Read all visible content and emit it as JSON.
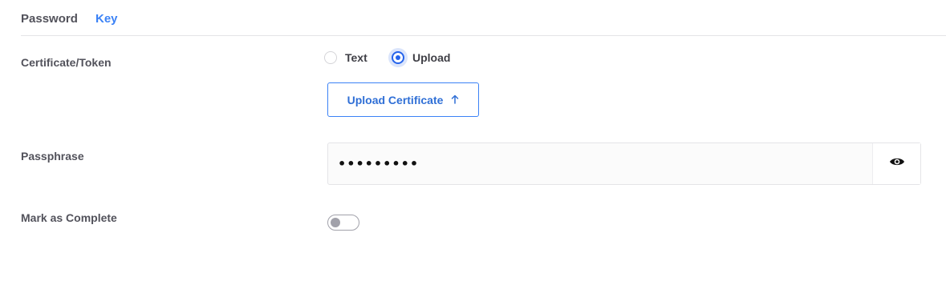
{
  "tabs": {
    "password": "Password",
    "key": "Key",
    "active": "Key"
  },
  "fields": {
    "certificate_label": "Certificate/Token",
    "radio_text": "Text",
    "radio_upload": "Upload",
    "selected_option": "Upload",
    "upload_button": "Upload Certificate",
    "upload_icon": "arrow-up-icon",
    "passphrase_label": "Passphrase",
    "passphrase_value": "•••••••••",
    "eye_icon": "eye-icon",
    "complete_label": "Mark as Complete",
    "complete_on": false
  },
  "colors": {
    "accent": "#3b82f6",
    "radio_selected": "#2563eb"
  }
}
